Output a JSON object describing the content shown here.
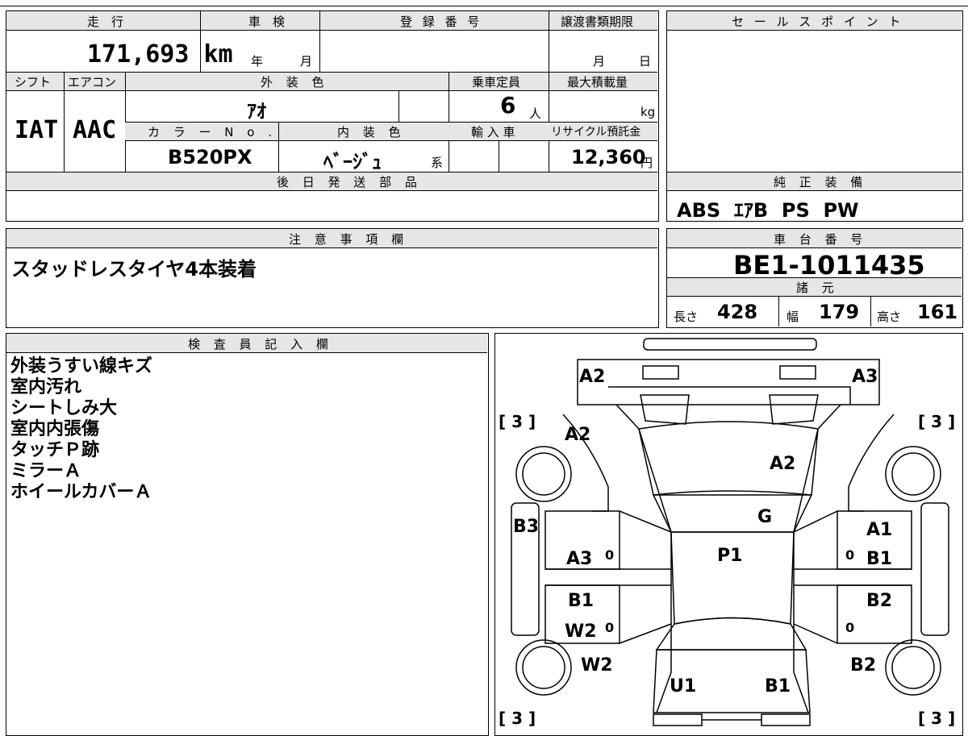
{
  "form": {
    "headers": {
      "mileage": "走　行",
      "shaken": "車　検",
      "registration": "登 録 番 号",
      "transfer_deadline": "譲渡書類期限",
      "sales_point": "セ ー ル ス ポ イ ン ト",
      "shift": "シフト",
      "aircon": "エアコン",
      "exterior_color": "外 装 色",
      "capacity": "乗車定員",
      "max_load": "最大積載量",
      "color_no": "カ ラ ー N o .",
      "interior_color": "内 装 色",
      "import": "輸 入 車",
      "recycle": "リサイクル預託金",
      "later_parts": "後 日 発 送 部 品",
      "genuine_equipment": "純 正 装 備",
      "notes": "注 意 事 項 欄",
      "chassis_no": "車 台 番 号",
      "specs": "諸 元",
      "inspector": "検 査 員 記 入 欄"
    },
    "values": {
      "mileage": "171,693",
      "mileage_unit": "km",
      "shaken_year": "年",
      "shaken_month": "月",
      "transfer_month": "月",
      "transfer_day": "日",
      "shift": "IAT",
      "aircon": "AAC",
      "exterior_color": "ｱｵ",
      "capacity": "6",
      "capacity_unit": "人",
      "max_load_unit": "kg",
      "color_no": "B520PX",
      "interior_color": "ﾍﾞｰｼﾞｭ",
      "interior_suffix": "系",
      "recycle": "12,360",
      "recycle_unit": "円",
      "genuine_equipment": "ABS  ｴｱB  PS  PW",
      "notes": "スタッドレスタイヤ4本装着",
      "chassis_no": "BE1-1011435",
      "length_label": "長さ",
      "length": "428",
      "width_label": "幅",
      "width": "179",
      "height_label": "高さ",
      "height": "161"
    },
    "inspector_remarks": [
      "外装うすい線キズ",
      "室内汚れ",
      "シートしみ大",
      "室内内張傷",
      "タッチＰ跡",
      "ミラーＡ",
      "ホイールカバーＡ"
    ]
  },
  "diagram": {
    "front_left": "A2",
    "front_right": "A3",
    "hood": "A2",
    "windshield": "A2",
    "fender_left": "A2",
    "cowl": "G",
    "roof": "P1",
    "left_side": "B3",
    "front_door_left": "A3",
    "front_door_right_1": "A1",
    "front_door_right_2": "B1",
    "rear_door_left_1": "B1",
    "rear_door_left_2": "W2",
    "rear_door_right": "B2",
    "rear_fender_left": "W2",
    "rear_fender_right": "B2",
    "rear_left": "U1",
    "rear_right": "B1",
    "tread_fl": "[ 3 ]",
    "tread_fr": "[ 3 ]",
    "tread_rl": "[ 3 ]",
    "tread_rr": "[ 3 ]",
    "zero": "0"
  }
}
